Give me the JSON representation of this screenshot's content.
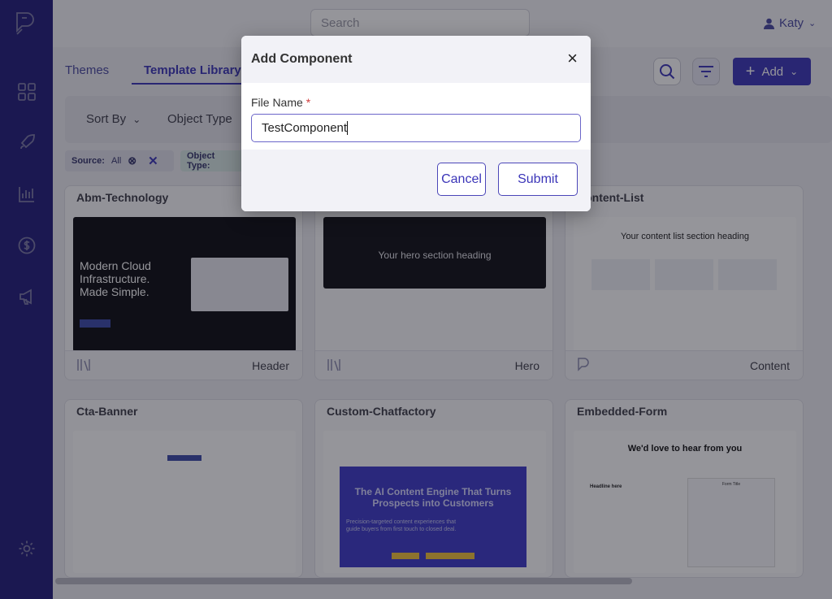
{
  "topbar": {
    "search_placeholder": "Search",
    "user_name": "Katy"
  },
  "tabs": [
    "Themes",
    "Template Library"
  ],
  "toolbar": {
    "add_label": "Add"
  },
  "filters": {
    "sort_by": "Sort By",
    "object_type": "Object Type"
  },
  "chips": {
    "source_label": "Source:",
    "source_value": "All",
    "object_type_label": "Object Type:"
  },
  "cards": [
    {
      "title": "Abm-Technology",
      "category": "Header"
    },
    {
      "title": "",
      "category": "Hero"
    },
    {
      "title": "Content-List",
      "category": "Content"
    },
    {
      "title": "Cta-Banner",
      "category": ""
    },
    {
      "title": "Custom-Chatfactory",
      "category": ""
    },
    {
      "title": "Embedded-Form",
      "category": ""
    }
  ],
  "thumbs": {
    "abm_headline": "Modern Cloud Infrastructure. Made Simple.",
    "hero_heading": "Your hero section heading",
    "content_list_heading": "Your content list section heading",
    "chat_headline": "The AI Content Engine That Turns Prospects into Customers",
    "chat_sub": "Precision-targeted content experiences that guide buyers from first touch to closed deal.",
    "form_heading": "We'd love to hear from you",
    "form_sub_heading": "Headline here",
    "form_title": "Form Title"
  },
  "modal": {
    "title": "Add Component",
    "close_symbol": "×",
    "field_label": "File Name",
    "required_mark": "*",
    "field_value": "TestComponent",
    "cancel_label": "Cancel",
    "submit_label": "Submit"
  },
  "colors": {
    "sidebar": "#221d7a",
    "accent": "#3b35b8",
    "required": "#d03c3c"
  }
}
